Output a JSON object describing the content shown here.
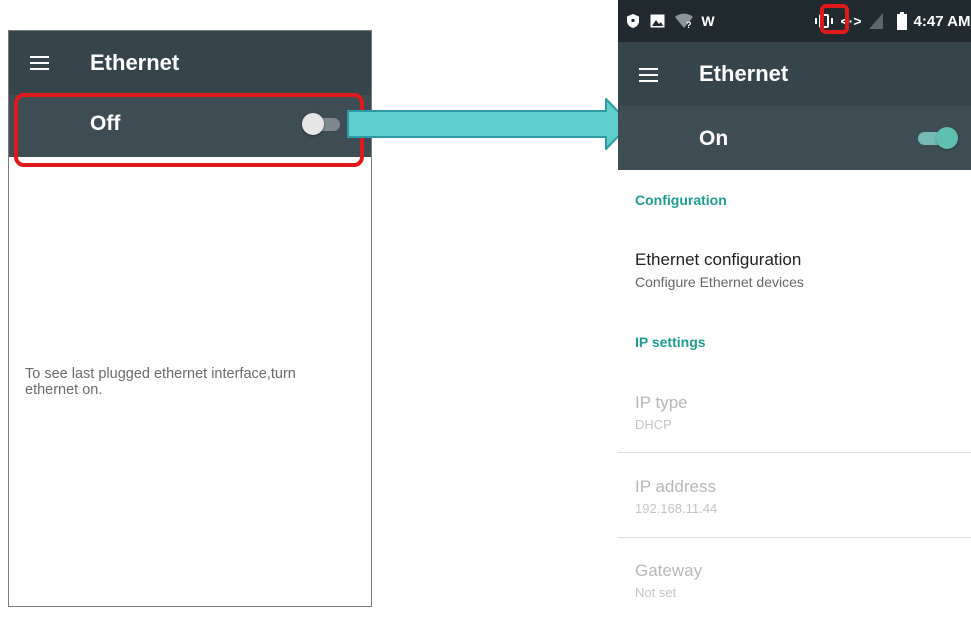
{
  "left_screen": {
    "toolbar": {
      "menu_icon": "hamburger-menu-icon",
      "title": "Ethernet"
    },
    "master_switch": {
      "label": "Off",
      "state": "off"
    },
    "empty_message": "To see last plugged ethernet interface,turn ethernet on."
  },
  "right_screen": {
    "status_bar": {
      "icons": [
        "shield-icon",
        "image-icon",
        "wifi-unknown-icon",
        "w-icon",
        "vibrate-icon",
        "ethernet-icon",
        "signal-icon",
        "battery-icon"
      ],
      "w_label": "W",
      "ethernet_glyph": "<·>",
      "time": "4:47 AM"
    },
    "toolbar": {
      "menu_icon": "hamburger-menu-icon",
      "title": "Ethernet"
    },
    "master_switch": {
      "label": "On",
      "state": "on"
    },
    "sections": {
      "configuration": {
        "header": "Configuration",
        "items": [
          {
            "title": "Ethernet configuration",
            "summary": "Configure Ethernet devices"
          }
        ]
      },
      "ip_settings": {
        "header": "IP settings",
        "items": [
          {
            "title": "IP type",
            "summary": "DHCP"
          },
          {
            "title": "IP address",
            "summary": "192.168.11.44"
          },
          {
            "title": "Gateway",
            "summary": "Not set"
          }
        ]
      }
    }
  },
  "colors": {
    "toolbar_bg": "#36444b",
    "switchbar_bg": "#3e4c53",
    "statusbar_bg": "#202a2f",
    "accent_teal": "#1e9e90",
    "highlight_red": "#e01a1a",
    "arrow_fill": "#5fcfce"
  }
}
